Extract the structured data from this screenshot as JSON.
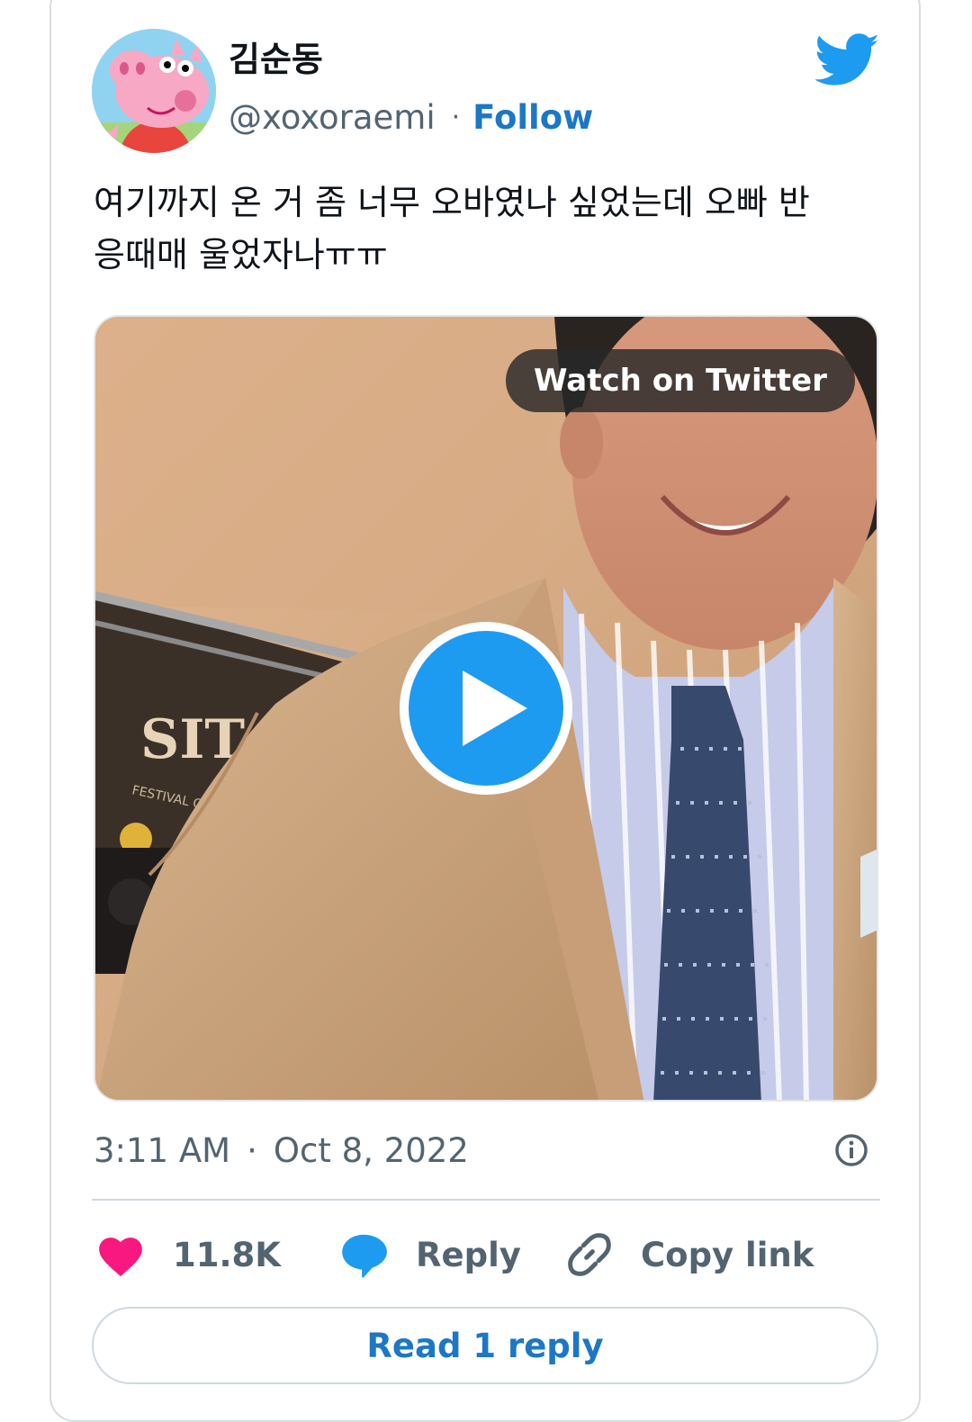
{
  "author": {
    "display_name": "김순동",
    "handle": "@xoxoraemi",
    "separator": "·",
    "follow_label": "Follow"
  },
  "tweet": {
    "text": "여기까지 온 거 좀 너무 오바였나 싶었는데 오빠 반\n응때매 울었자나ㅠㅠ"
  },
  "media": {
    "watch_label": "Watch on Twitter",
    "play_icon": "play-icon",
    "backdrop_text": "SIT",
    "backdrop_subtext": "FESTIVAL CINEMA"
  },
  "meta": {
    "time": "3:11 AM",
    "separator": "·",
    "date": "Oct 8, 2022",
    "info_icon": "info-icon"
  },
  "actions": {
    "like_count": "11.8K",
    "reply_label": "Reply",
    "copy_label": "Copy link"
  },
  "read_replies_label": "Read 1 reply",
  "colors": {
    "link_blue": "#1d77c5",
    "twitter_blue": "#1d9bf0",
    "like_pink": "#f91880",
    "muted_text": "#536471"
  }
}
